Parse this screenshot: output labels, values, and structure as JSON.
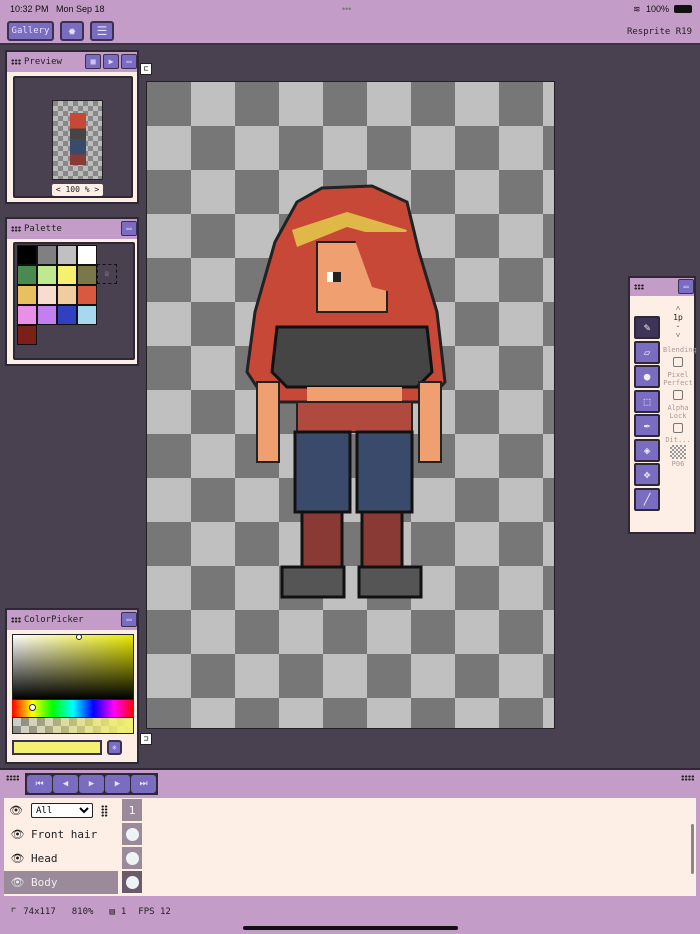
{
  "status": {
    "time": "10:32 PM",
    "date": "Mon Sep 18",
    "battery": "100%"
  },
  "toolbar": {
    "gallery": "Gallery",
    "settings_icon": "gear-icon",
    "adjust_icon": "sliders-icon",
    "app_version": "Resprite R19"
  },
  "preview": {
    "title": "Preview",
    "zoom": "< 100 % >"
  },
  "palette": {
    "title": "Palette",
    "colors": [
      "#000000",
      "#808080",
      "#c0c0c0",
      "#ffffff",
      "#4a8a50",
      "#c0e890",
      "#f4f070",
      "#7a7848",
      "#e8c060",
      "#f8dcd0",
      "#f0cca0",
      "#d85840",
      "#e890e8",
      "#c080f0",
      "#3040c0",
      "#a8d8f0",
      "#7a2018"
    ]
  },
  "colorpicker": {
    "title": "ColorPicker",
    "current": "#f4f070"
  },
  "tools": {
    "brush_size": "1p",
    "blending": "Blending",
    "pixel_perfect": "Pixel Perfect",
    "alpha_lock": "Alpha Lock",
    "dither": "Dit...",
    "pattern": "P06"
  },
  "layers": {
    "filter": "All",
    "frame": "1",
    "items": [
      {
        "name": "Front hair",
        "selected": false
      },
      {
        "name": "Head",
        "selected": false
      },
      {
        "name": "Body",
        "selected": true
      }
    ]
  },
  "footer": {
    "size": "74x117",
    "zoom": "810%",
    "frames": "1",
    "fps": "FPS 12"
  }
}
